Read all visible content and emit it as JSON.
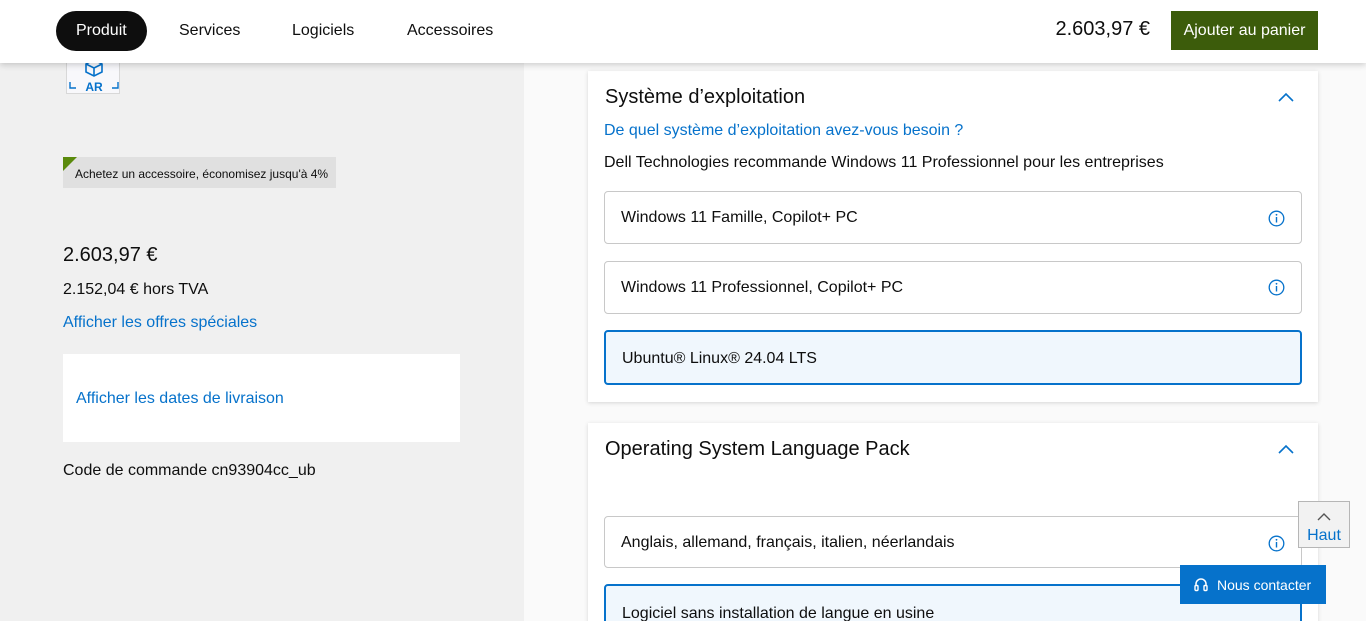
{
  "nav": {
    "tabs": [
      {
        "label": "Produit",
        "active": true
      },
      {
        "label": "Services",
        "active": false
      },
      {
        "label": "Logiciels",
        "active": false
      },
      {
        "label": "Accessoires",
        "active": false
      }
    ],
    "price": "2.603,97 €",
    "cart_button": "Ajouter au panier"
  },
  "left": {
    "ar_badge": "AR",
    "promo_text": "Achetez un accessoire, économisez jusqu'à 4%",
    "price": "2.603,97 €",
    "price_excl_tax": "2.152,04 € hors TVA",
    "offers_link": "Afficher les offres spéciales",
    "delivery_link": "Afficher les dates de livraison",
    "order_code": "Code de commande cn93904cc_ub"
  },
  "os_section": {
    "title": "Système d’exploitation",
    "question_link": "De quel système d’exploitation avez-vous besoin ?",
    "recommendation": "Dell Technologies recommande Windows 11 Professionnel pour les entreprises",
    "options": [
      {
        "label": "Windows 11 Famille, Copilot+ PC",
        "selected": false,
        "info_icon": "info-circle-icon"
      },
      {
        "label": "Windows 11 Professionnel, Copilot+ PC",
        "selected": false,
        "info_icon": "info-circle-icon"
      },
      {
        "label": "Ubuntu® Linux® 24.04 LTS",
        "selected": true
      }
    ]
  },
  "lang_section": {
    "title": "Operating System Language Pack",
    "options": [
      {
        "label": "Anglais, allemand, français, italien, néerlandais",
        "selected": false,
        "info_icon": "info-circle-icon"
      },
      {
        "label": "Logiciel sans installation de langue en usine",
        "selected": true
      }
    ]
  },
  "floating": {
    "top_button": "Haut",
    "contact_button": "Nous contacter"
  },
  "colors": {
    "accent_blue": "#0672cb",
    "cart_green": "#3c5c0b",
    "promo_green": "#5a8a0c"
  }
}
